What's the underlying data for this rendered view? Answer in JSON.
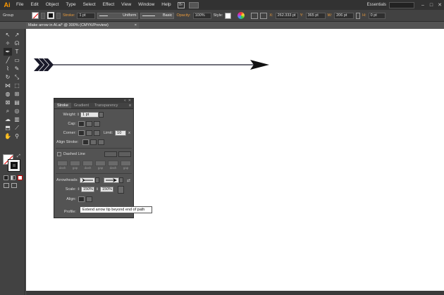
{
  "app": {
    "logo": "Ai"
  },
  "menu": [
    "File",
    "Edit",
    "Object",
    "Type",
    "Select",
    "Effect",
    "View",
    "Window",
    "Help"
  ],
  "workspace": "Essentials",
  "control_bar": {
    "selection": "Group",
    "stroke_label": "Stroke:",
    "stroke_weight": "1 pt",
    "profile": "Uniform",
    "brush": "Basic",
    "opacity_label": "Opacity:",
    "opacity": "100%",
    "style_label": "Style:",
    "x_label": "X:",
    "x": "262.333 pt",
    "y_label": "Y:",
    "y": "365 pt",
    "w_label": "W:",
    "w": "206 pt",
    "h_label": "H:",
    "h": "0 pt"
  },
  "document_tab": "Make arrow in AI.ai* @ 300% (CMYK/Preview)",
  "stroke_panel": {
    "tabs": [
      "Stroke",
      "Gradient",
      "Transparency"
    ],
    "weight_label": "Weight:",
    "weight": "1 pt",
    "cap_label": "Cap:",
    "corner_label": "Corner:",
    "limit_label": "Limit:",
    "limit": "10",
    "limit_unit": "x",
    "align_label": "Align Stroke:",
    "dashed_label": "Dashed Line",
    "dash_labels": [
      "dash",
      "gap",
      "dash",
      "gap",
      "dash",
      "gap"
    ],
    "arrowheads_label": "Arrowheads:",
    "scale_label": "Scale:",
    "scale_start": "150%",
    "scale_end": "150%",
    "align_arrow_label": "Align:",
    "profile_label": "Profile:"
  },
  "tooltip": "Extend arrow tip beyond end of path",
  "icons": [
    "selection-tool-icon",
    "direct-selection-icon",
    "magic-wand-icon",
    "lasso-icon",
    "pen-icon",
    "type-icon",
    "line-icon",
    "rectangle-icon",
    "paintbrush-icon",
    "pencil-icon",
    "rotate-icon",
    "scale-icon",
    "width-icon",
    "free-transform-icon",
    "shape-builder-icon",
    "perspective-icon",
    "mesh-icon",
    "gradient-icon",
    "eyedropper-icon",
    "blend-icon",
    "symbol-sprayer-icon",
    "column-graph-icon",
    "artboard-icon",
    "slice-icon",
    "hand-icon",
    "zoom-icon"
  ]
}
